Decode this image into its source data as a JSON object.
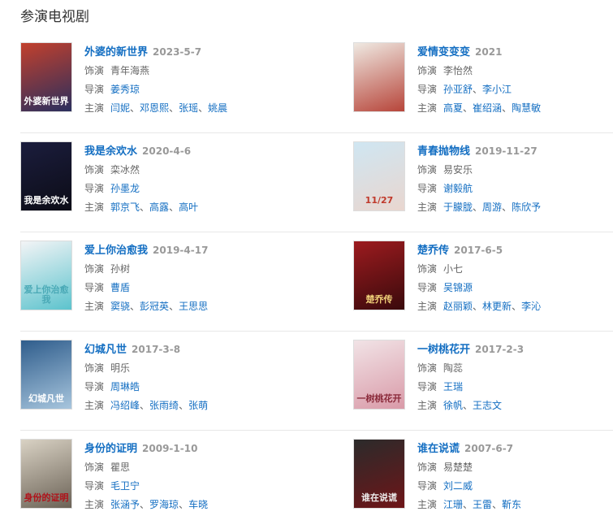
{
  "section_title": "参演电视剧",
  "labels": {
    "role": "饰演",
    "director": "导演",
    "cast": "主演"
  },
  "shows": [
    {
      "title": "外婆的新世界",
      "date": "2023-5-7",
      "role": "青年海燕",
      "directors": [
        "姜秀琼"
      ],
      "cast": [
        "闫妮",
        "邓恩熙",
        "张瑶",
        "姚晨"
      ],
      "poster": {
        "bg1": "#c2402d",
        "bg2": "#2a2f5e",
        "text": "外婆新世界",
        "textColor": "#ffffff"
      }
    },
    {
      "title": "爱情变变变",
      "date": "2021",
      "role": "李怡然",
      "directors": [
        "孙亚舒",
        "李小江"
      ],
      "cast": [
        "高夏",
        "崔绍涵",
        "陶慧敏"
      ],
      "poster": {
        "bg1": "#efe9e2",
        "bg2": "#b7453a",
        "text": "",
        "textColor": "#333333"
      }
    },
    {
      "title": "我是余欢水",
      "date": "2020-4-6",
      "role": "栾冰然",
      "directors": [
        "孙墨龙"
      ],
      "cast": [
        "郭京飞",
        "高露",
        "高叶"
      ],
      "poster": {
        "bg1": "#1b1d3d",
        "bg2": "#0c0c16",
        "text": "我是余欢水",
        "textColor": "#ffffff"
      }
    },
    {
      "title": "青春抛物线",
      "date": "2019-11-27",
      "role": "易安乐",
      "directors": [
        "谢毅航"
      ],
      "cast": [
        "于朦胧",
        "周游",
        "陈欣予"
      ],
      "poster": {
        "bg1": "#cfe6f2",
        "bg2": "#e9d6cf",
        "text": "11/27",
        "textColor": "#c0392b"
      }
    },
    {
      "title": "爱上你治愈我",
      "date": "2019-4-17",
      "role": "孙树",
      "directors": [
        "曹盾"
      ],
      "cast": [
        "窦骁",
        "彭冠英",
        "王思思"
      ],
      "poster": {
        "bg1": "#f3f4f6",
        "bg2": "#5cc3cd",
        "text": "爱上你治愈我",
        "textColor": "#4aa9b6"
      }
    },
    {
      "title": "楚乔传",
      "date": "2017-6-5",
      "role": "小七",
      "directors": [
        "吴锦源"
      ],
      "cast": [
        "赵丽颖",
        "林更新",
        "李沁"
      ],
      "poster": {
        "bg1": "#9c1b1f",
        "bg2": "#3a0a0c",
        "text": "楚乔传",
        "textColor": "#f2d27a"
      }
    },
    {
      "title": "幻城凡世",
      "date": "2017-3-8",
      "role": "明乐",
      "directors": [
        "周琳皓"
      ],
      "cast": [
        "冯绍峰",
        "张雨绮",
        "张萌"
      ],
      "poster": {
        "bg1": "#2f5d8c",
        "bg2": "#a7c5dd",
        "text": "幻城凡世",
        "textColor": "#ffffff"
      }
    },
    {
      "title": "一树桃花开",
      "date": "2017-2-3",
      "role": "陶蕊",
      "directors": [
        "王瑞"
      ],
      "cast": [
        "徐帆",
        "王志文"
      ],
      "poster": {
        "bg1": "#f1e3e6",
        "bg2": "#d99aa8",
        "text": "一树桃花开",
        "textColor": "#8a2a3a"
      }
    },
    {
      "title": "身份的证明",
      "date": "2009-1-10",
      "role": "瞿思",
      "directors": [
        "毛卫宁"
      ],
      "cast": [
        "张涵予",
        "罗海琼",
        "车晓"
      ],
      "poster": {
        "bg1": "#d9d2c4",
        "bg2": "#6b6256",
        "text": "身份的证明",
        "textColor": "#b0121a"
      }
    },
    {
      "title": "谁在说谎",
      "date": "2007-6-7",
      "role": "易楚楚",
      "directors": [
        "刘二威"
      ],
      "cast": [
        "江珊",
        "王雷",
        "靳东"
      ],
      "poster": {
        "bg1": "#2b2b2b",
        "bg2": "#6e1518",
        "text": "谁在说谎",
        "textColor": "#f0f0f0"
      }
    }
  ]
}
